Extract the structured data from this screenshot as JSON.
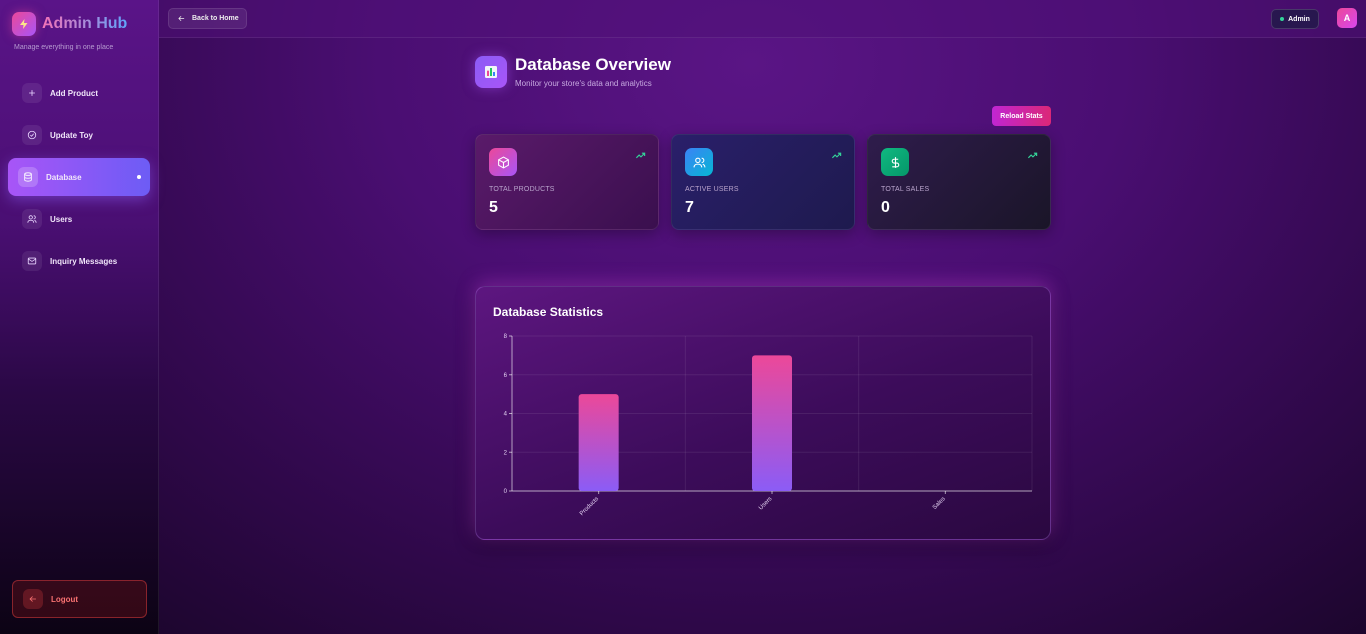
{
  "brand": {
    "title": "Admin Hub",
    "subtitle": "Manage everything in one place"
  },
  "sidebar": {
    "items": [
      {
        "label": "Add Product",
        "icon": "plus-icon"
      },
      {
        "label": "Update Toy",
        "icon": "check-circle-icon"
      },
      {
        "label": "Database",
        "icon": "database-icon",
        "active": true
      },
      {
        "label": "Users",
        "icon": "users-icon"
      },
      {
        "label": "Inquiry Messages",
        "icon": "mail-icon"
      }
    ],
    "logout_label": "Logout"
  },
  "topbar": {
    "back_label": "Back to Home",
    "admin_label": "Admin",
    "avatar_letter": "A"
  },
  "page": {
    "title": "Database Overview",
    "subtitle": "Monitor your store's data and analytics",
    "reload_label": "Reload Stats"
  },
  "stats": [
    {
      "label": "TOTAL PRODUCTS",
      "value": "5",
      "icon": "box-icon"
    },
    {
      "label": "ACTIVE USERS",
      "value": "7",
      "icon": "users-icon"
    },
    {
      "label": "TOTAL SALES",
      "value": "0",
      "icon": "dollar-icon"
    }
  ],
  "colors": {
    "accent_pink": "#ec4899",
    "accent_purple": "#8b5cf6",
    "trend_green": "#34d399"
  },
  "chart_data": {
    "type": "bar",
    "title": "Database Statistics",
    "categories": [
      "Products",
      "Users",
      "Sales"
    ],
    "values": [
      5,
      7,
      0
    ],
    "ylim": [
      0,
      8
    ],
    "yticks": [
      0,
      2,
      4,
      6,
      8
    ],
    "xlabel": "",
    "ylabel": "",
    "grid": true
  }
}
